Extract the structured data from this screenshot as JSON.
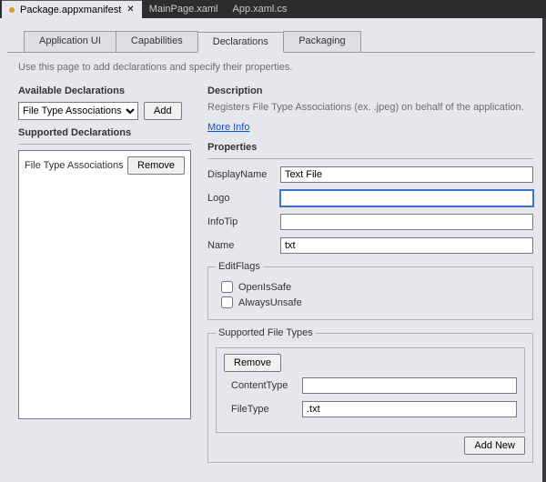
{
  "doc_tabs": {
    "active": "Package.appxmanifest",
    "items": [
      {
        "label": "Package.appxmanifest"
      },
      {
        "label": "MainPage.xaml"
      },
      {
        "label": "App.xaml.cs"
      }
    ]
  },
  "manifest_tabs": {
    "items": [
      {
        "label": "Application UI"
      },
      {
        "label": "Capabilities"
      },
      {
        "label": "Declarations"
      },
      {
        "label": "Packaging"
      }
    ],
    "active": "Declarations"
  },
  "hint": "Use this page to add declarations and specify their properties.",
  "available": {
    "heading": "Available Declarations",
    "selected": "File Type Associations",
    "add_label": "Add"
  },
  "supported": {
    "heading": "Supported Declarations",
    "items": [
      {
        "label": "File Type Associations"
      }
    ],
    "remove_label": "Remove"
  },
  "description": {
    "heading": "Description",
    "text": "Registers File Type Associations (ex. .jpeg) on behalf of the application.",
    "more_info": "More Info"
  },
  "properties": {
    "heading": "Properties",
    "display_name_label": "DisplayName",
    "display_name": "Text File",
    "logo_label": "Logo",
    "logo": "",
    "info_tip_label": "InfoTip",
    "info_tip": "",
    "name_label": "Name",
    "name": "txt",
    "edit_flags": {
      "legend": "EditFlags",
      "open_is_safe_label": "OpenIsSafe",
      "open_is_safe": false,
      "always_unsafe_label": "AlwaysUnsafe",
      "always_unsafe": false
    },
    "supported_file_types": {
      "legend": "Supported File Types",
      "remove_label": "Remove",
      "content_type_label": "ContentType",
      "content_type": "",
      "file_type_label": "FileType",
      "file_type": ".txt",
      "add_new_label": "Add New"
    }
  }
}
